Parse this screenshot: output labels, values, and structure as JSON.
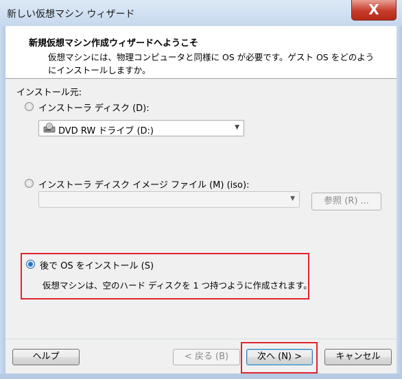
{
  "window": {
    "title": "新しい仮想マシン ウィザード",
    "close_label": "X"
  },
  "header": {
    "title": "新規仮想マシン作成ウィザードへようこそ",
    "description": "仮想マシンには、物理コンピュータと同様に OS が必要です。ゲスト OS をどのようにインストールしますか。"
  },
  "source": {
    "label": "インストール元:",
    "installer_disc": {
      "label": "インストーラ ディスク (D):",
      "selected": false,
      "drive_value": "DVD RW ドライブ (D:)"
    },
    "iso_image": {
      "label": "インストーラ ディスク イメージ ファイル (M) (iso):",
      "selected": false,
      "path_value": "",
      "browse_label": "参照 (R) ..."
    },
    "install_later": {
      "label": "後で OS をインストール (S)",
      "selected": true,
      "description": "仮想マシンは、空のハード ディスクを 1 つ持つように作成されます。"
    }
  },
  "footer": {
    "help_label": "ヘルプ",
    "back_label": "< 戻る (B)",
    "next_label": "次へ (N) >",
    "cancel_label": "キャンセル"
  },
  "colors": {
    "highlight": "#e0242b",
    "close_button": "#c73b2b"
  }
}
